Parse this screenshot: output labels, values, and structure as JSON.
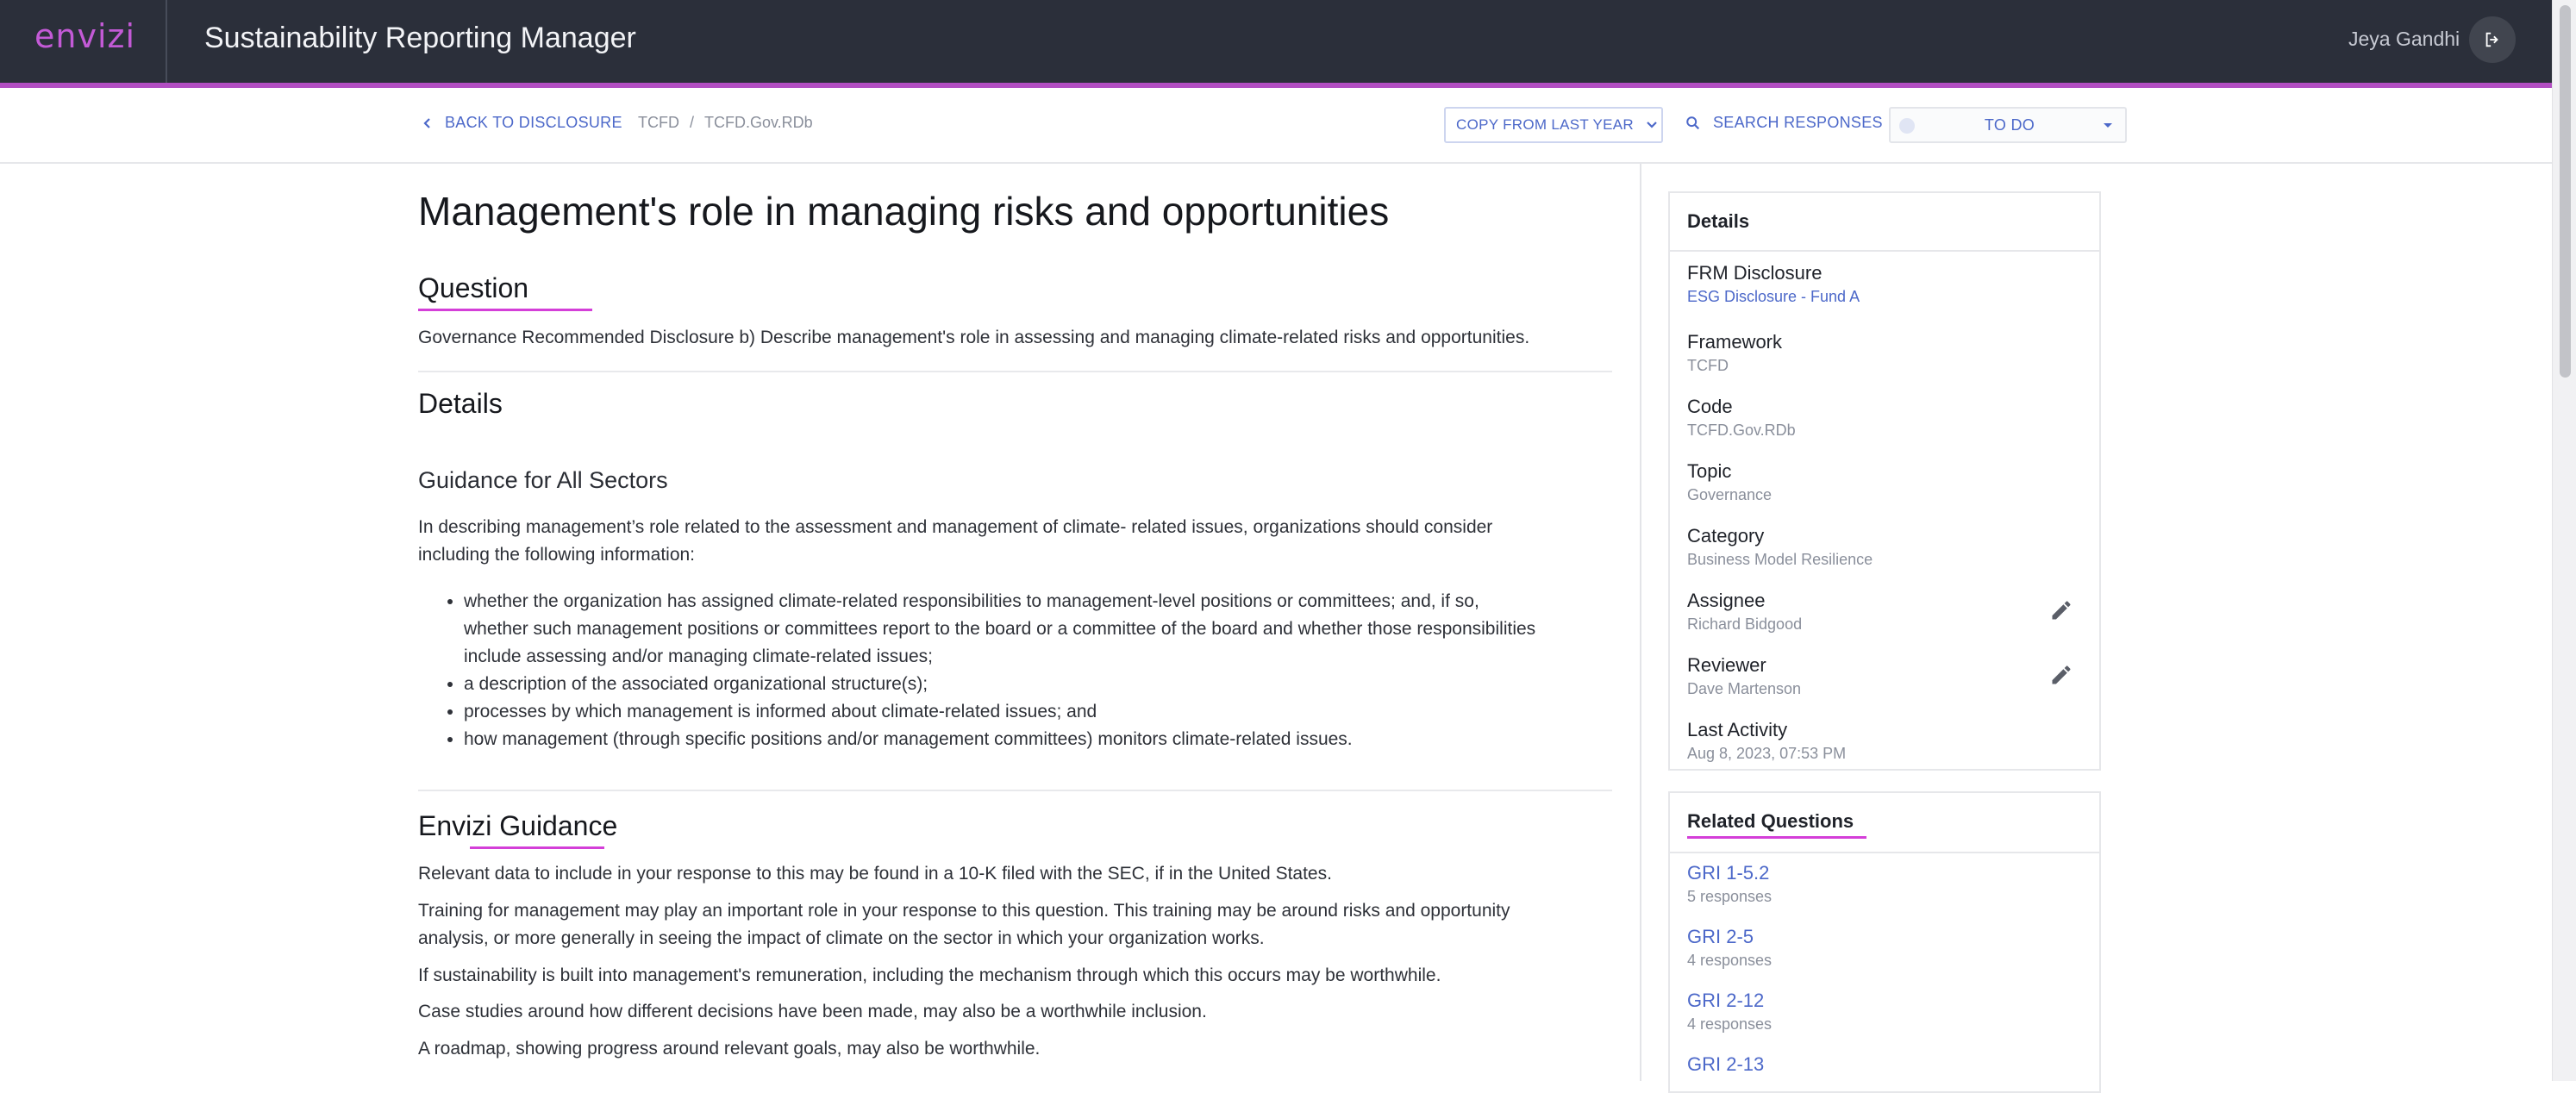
{
  "header": {
    "logo": "envizi",
    "app_title": "Sustainability Reporting Manager",
    "user_name": "Jeya Gandhi",
    "logout_icon": "logout-icon"
  },
  "toolbar": {
    "back_label": "BACK TO DISCLOSURE",
    "breadcrumb": [
      "TCFD",
      "TCFD.Gov.RDb"
    ],
    "breadcrumb_sep": "/",
    "copy_label": "COPY FROM LAST YEAR",
    "search_label": "SEARCH RESPONSES",
    "status_value": "TO DO"
  },
  "main": {
    "title": "Management's role in managing risks and opportunities",
    "question_heading": "Question",
    "question_text": "Governance Recommended Disclosure b) Describe management's role in assessing and managing climate-related risks and opportunities.",
    "details_heading": "Details",
    "guidance_heading": "Guidance for All Sectors",
    "guidance_intro_1": "In describing management’s role related to the assessment and management of climate- related issues, organizations should consider",
    "guidance_intro_2": "including the following information:",
    "guidance_items": [
      [
        "whether the organization has assigned climate-related responsibilities to management-level positions or committees; and, if so,",
        "whether such management positions or committees report to the board or a committee of the board and whether those responsibilities",
        "include assessing and/or managing climate-related issues;"
      ],
      [
        "a description of the associated organizational structure(s);"
      ],
      [
        "processes by which management is informed about climate-related issues; and"
      ],
      [
        "how management (through specific positions and/or management committees) monitors climate-related issues."
      ]
    ],
    "envizi_heading": "Envizi Guidance",
    "envizi_paras": [
      [
        "Relevant data to include in your response to this may be found in a 10-K filed with the SEC, if in the United States."
      ],
      [
        "Training for management may play an important role in your response to this question. This training may be around risks and opportunity",
        "analysis, or more generally in seeing the impact of climate on the sector in which your organization works."
      ],
      [
        "If sustainability is built into management's remuneration, including the mechanism through which this occurs may be worthwhile."
      ],
      [
        "Case studies around how different decisions have been made, may also be a worthwhile inclusion."
      ],
      [
        "A roadmap, showing progress around relevant goals, may also be worthwhile."
      ]
    ]
  },
  "details_panel": {
    "title": "Details",
    "items": [
      {
        "label": "FRM Disclosure",
        "value": "ESG Disclosure - Fund A"
      },
      {
        "label": "Framework",
        "value": "TCFD"
      },
      {
        "label": "Code",
        "value": "TCFD.Gov.RDb"
      },
      {
        "label": "Topic",
        "value": "Governance"
      },
      {
        "label": "Category",
        "value": "Business Model Resilience"
      },
      {
        "label": "Assignee",
        "value": "Richard Bidgood"
      },
      {
        "label": "Reviewer",
        "value": "Dave Martenson"
      },
      {
        "label": "Last Activity",
        "value": "Aug 8, 2023, 07:53 PM"
      }
    ]
  },
  "related_panel": {
    "title": "Related Questions",
    "items": [
      {
        "code": "GRI 1-5.2",
        "count": "5 responses"
      },
      {
        "code": "GRI 2-5",
        "count": "4 responses"
      },
      {
        "code": "GRI 2-12",
        "count": "4 responses"
      },
      {
        "code": "GRI 2-13",
        "count": ""
      }
    ]
  },
  "colors": {
    "accent": "#b24ec2",
    "link": "#4c68c9",
    "underline": "#d43fd8",
    "topbar": "#2b2f3a"
  }
}
